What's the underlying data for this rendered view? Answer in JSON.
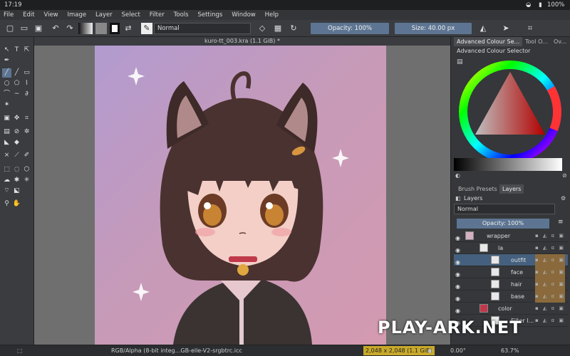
{
  "status": {
    "time": "17:19",
    "battery": "100%"
  },
  "menu": [
    "File",
    "Edit",
    "View",
    "Image",
    "Layer",
    "Select",
    "Filter",
    "Tools",
    "Settings",
    "Window",
    "Help"
  ],
  "toolbar": {
    "blend_mode": "Normal",
    "opacity": "Opacity: 100%",
    "size": "Size: 40.00 px"
  },
  "document": {
    "tab_title": "kuro-tt_003.kra (1.1 GiB)  *"
  },
  "dock": {
    "top_tabs": [
      "Advanced Colour Se...",
      "Tool O...",
      "Ov..."
    ],
    "color_selector_title": "Advanced Colour Selector",
    "mid_tabs": [
      "Brush Presets",
      "Layers"
    ],
    "layers_title": "Layers",
    "layer_blend": "Normal",
    "layer_opacity": "Opacity:  100%",
    "layers": [
      {
        "name": "wrapper",
        "indent": 0
      },
      {
        "name": "la",
        "indent": 1
      },
      {
        "name": "outfit",
        "indent": 2,
        "selected": true
      },
      {
        "name": "face",
        "indent": 2
      },
      {
        "name": "hair",
        "indent": 2
      },
      {
        "name": "base",
        "indent": 2
      },
      {
        "name": "color",
        "indent": 1
      },
      {
        "name": "Filter l...",
        "indent": 2
      }
    ]
  },
  "bottom": {
    "color_info": "RGB/Alpha (8-bit integ...GB-elle-V2-srgbtrc.icc",
    "dimensions": "2,048 x 2,048 (1.1 GiB)",
    "rotation": "0.00°",
    "zoom": "63.7%"
  },
  "watermark": "PLAY-ARK.NET",
  "colors": {
    "accent": "#5d7592",
    "canvas_bg": "#b29bd0"
  }
}
